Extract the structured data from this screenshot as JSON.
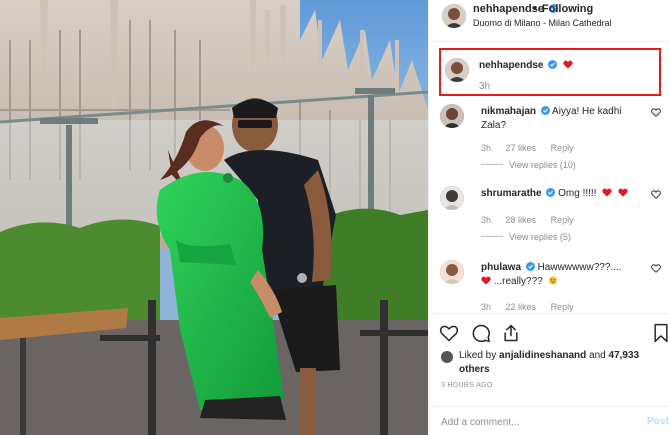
{
  "colors": {
    "accent_red": "#e11d1d",
    "verified_blue": "#3897f0",
    "dress_green": "#22b94a",
    "muted": "#8e8e8e"
  },
  "post": {
    "username": "nehhapendse",
    "dot": "•",
    "follow_status": "Following",
    "location": "Duomo di Milano - Milan Cathedral"
  },
  "caption": {
    "username": "nehhapendse",
    "emoji": "heart-emoji",
    "time": "3h"
  },
  "comments": [
    {
      "username": "nikmahajan",
      "text": "Aiyya! He kadhi Zala?",
      "time": "3h",
      "likes": "27 likes",
      "reply": "Reply",
      "view_replies": "View replies (10)"
    },
    {
      "username": "shrumarathe",
      "text": "Omg !!!!!",
      "time": "3h",
      "likes": "28 likes",
      "reply": "Reply",
      "view_replies": "View replies (5)"
    },
    {
      "username": "phulawa",
      "text": "Hawwwwww???....",
      "text2": "...really???",
      "time": "3h",
      "likes": "22 likes",
      "reply": "Reply"
    }
  ],
  "likes": {
    "prefix": "Liked by",
    "user": "anjalidineshanand",
    "and": "and",
    "count": "47,933 others"
  },
  "timestamp": "3 HOURS AGO",
  "add_comment": {
    "placeholder": "Add a comment...",
    "post_label": "Post"
  },
  "icons": [
    "heart-icon",
    "comment-icon",
    "share-icon",
    "bookmark-icon",
    "verified-badge-icon",
    "more-options-icon"
  ]
}
